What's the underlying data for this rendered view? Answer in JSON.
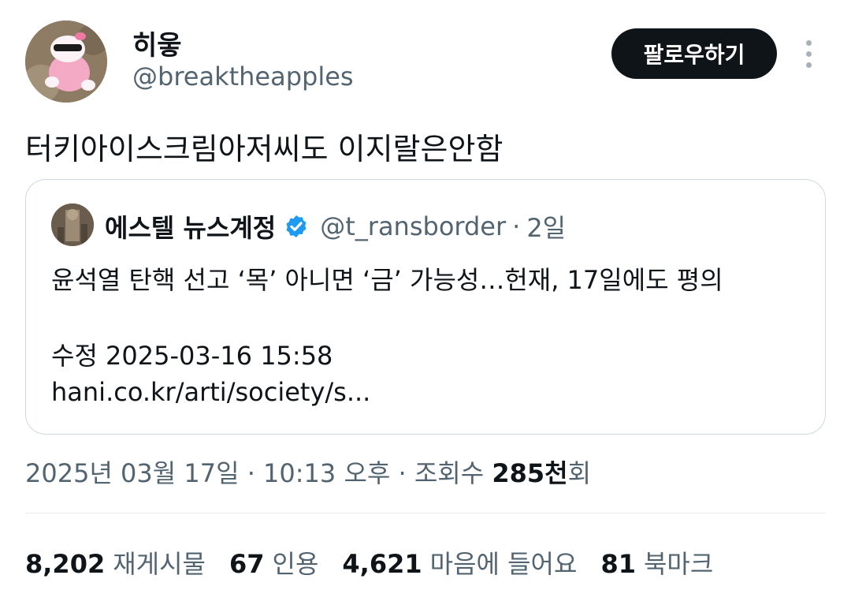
{
  "author": {
    "display_name": "히읗",
    "handle": "@breaktheapples"
  },
  "follow_label": "팔로우하기",
  "tweet_text": "터키아이스크림아저씨도 이지랄은안함",
  "quoted": {
    "display_name": "에스텔 뉴스계정",
    "handle": "@t_ransborder",
    "separator": "·",
    "time": "2일",
    "line1": "윤석열 탄핵 선고 ‘목’ 아니면 ‘금’ 가능성…헌재, 17일에도 평의",
    "line2": "수정 2025-03-16 15:58",
    "line3": "hani.co.kr/arti/society/s..."
  },
  "meta": {
    "datetime": "2025년 03월 17일 · 10:13 오후 · 조회수 ",
    "views_num": "285천",
    "views_suffix": "회"
  },
  "stats": [
    {
      "num": "8,202",
      "label": "재게시물"
    },
    {
      "num": "67",
      "label": "인용"
    },
    {
      "num": "4,621",
      "label": "마음에 들어요"
    },
    {
      "num": "81",
      "label": "북마크"
    }
  ],
  "colors": {
    "text": "#0f1419",
    "secondary": "#536471",
    "verified": "#1d9bf0",
    "border": "#cfd9de"
  }
}
